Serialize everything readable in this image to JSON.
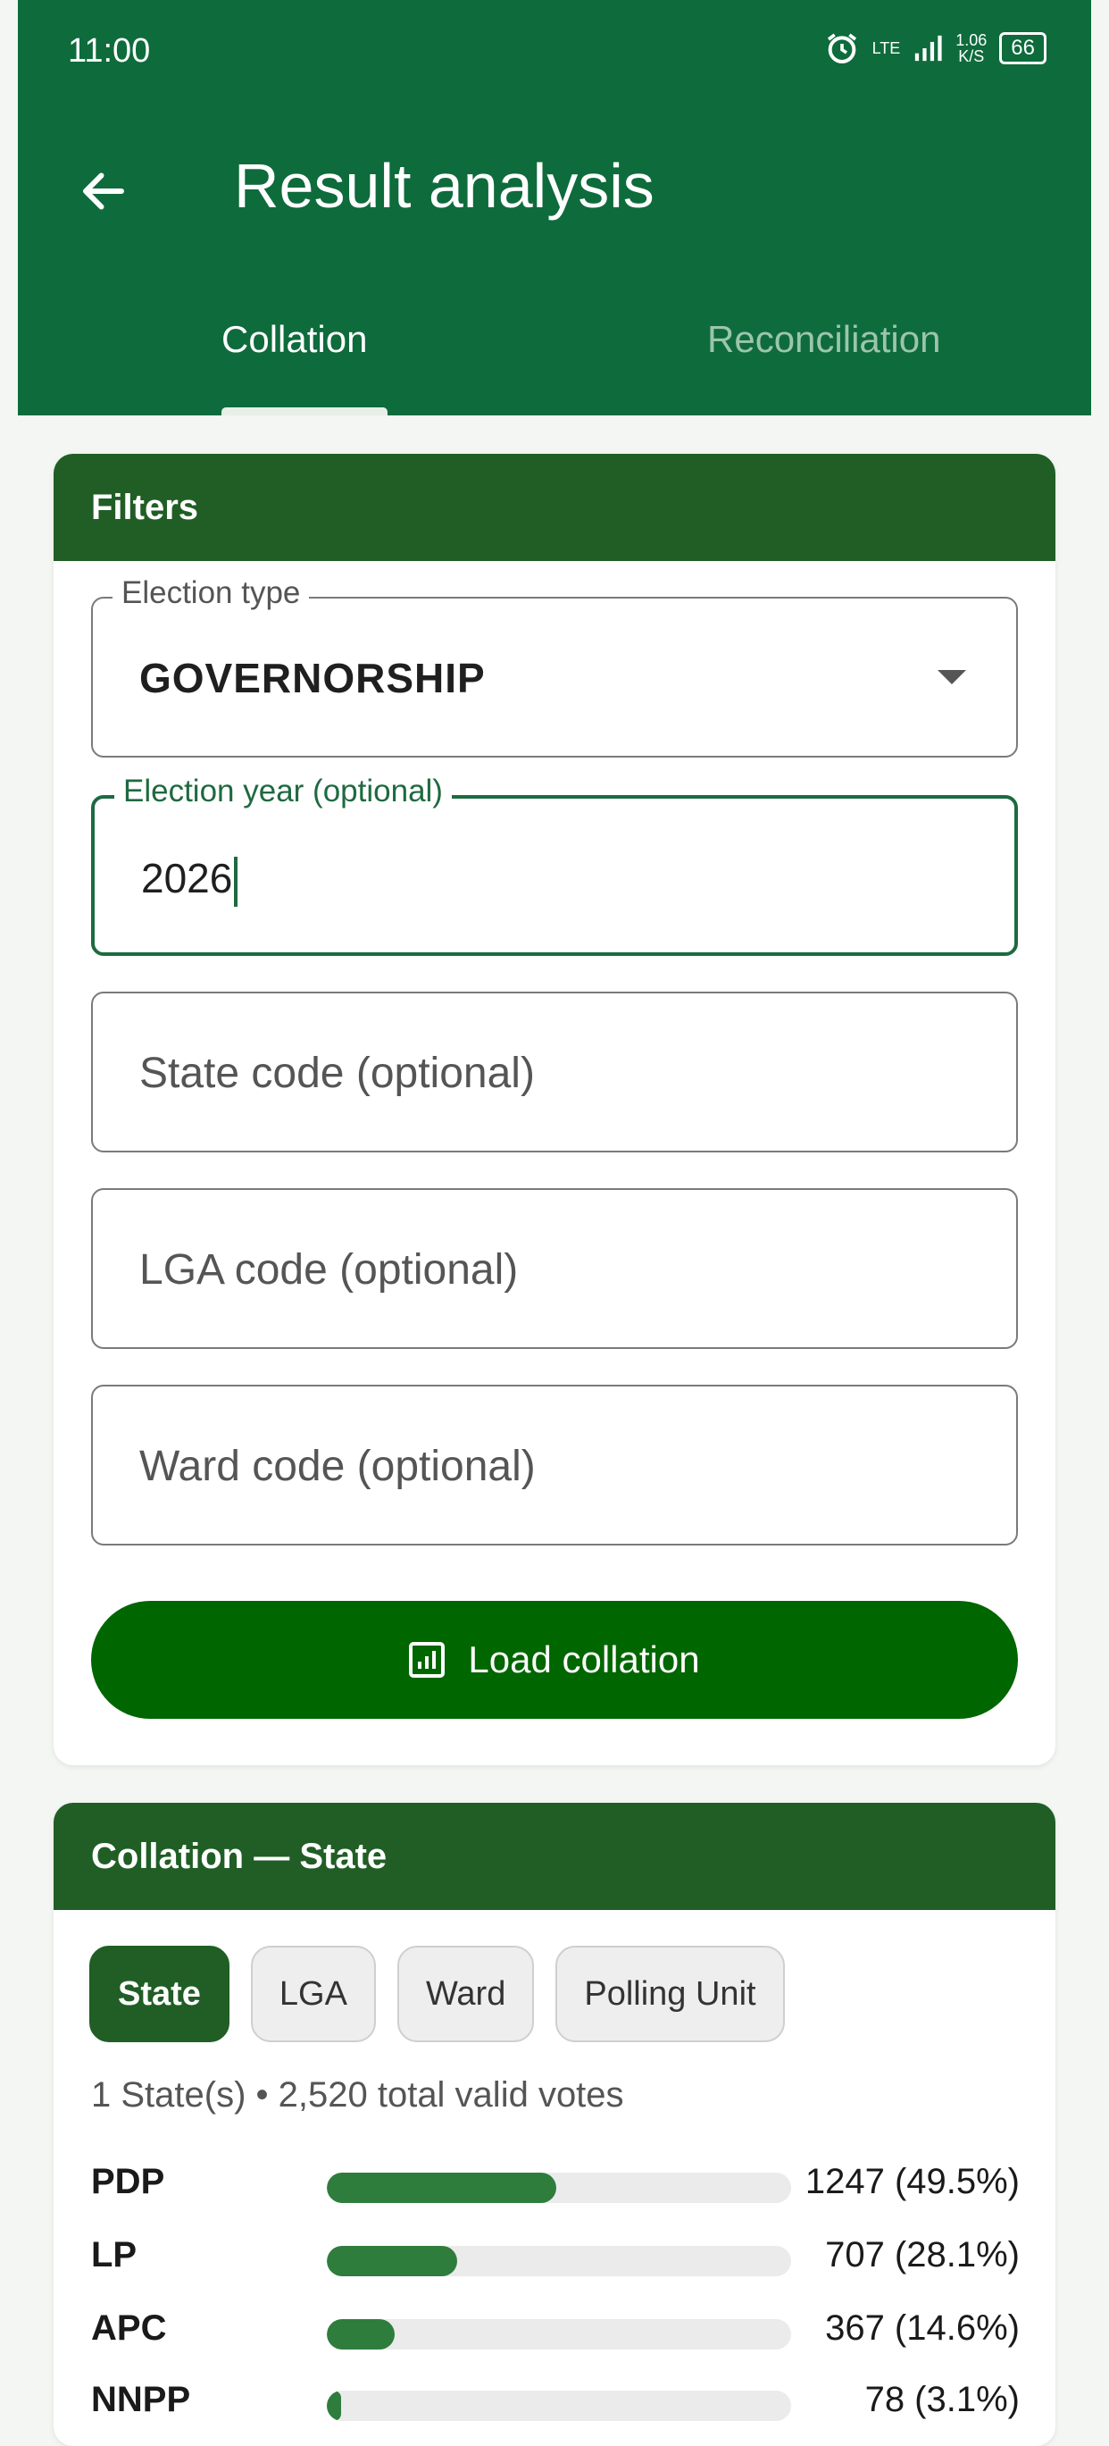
{
  "status_bar": {
    "time": "11:00",
    "network": "LTE",
    "speed_value": "1.06",
    "speed_unit": "K/S",
    "battery": "66"
  },
  "header": {
    "title": "Result analysis",
    "tabs": [
      {
        "label": "Collation",
        "active": true
      },
      {
        "label": "Reconciliation",
        "active": false
      }
    ]
  },
  "filters": {
    "header": "Filters",
    "election_type": {
      "label": "Election type",
      "value": "GOVERNORSHIP"
    },
    "election_year": {
      "label": "Election year (optional)",
      "value": "2026"
    },
    "state_code": {
      "placeholder": "State code (optional)"
    },
    "lga_code": {
      "placeholder": "LGA code (optional)"
    },
    "ward_code": {
      "placeholder": "Ward code (optional)"
    },
    "load_button": "Load collation"
  },
  "collation": {
    "header": "Collation — State",
    "chips": [
      {
        "label": "State",
        "selected": true
      },
      {
        "label": "LGA",
        "selected": false
      },
      {
        "label": "Ward",
        "selected": false
      },
      {
        "label": "Polling Unit",
        "selected": false
      }
    ],
    "summary": "1 State(s) • 2,520 total valid votes",
    "results": [
      {
        "party": "PDP",
        "votes": "1247 (49.5%)",
        "share": 0.495
      },
      {
        "party": "LP",
        "votes": "707 (28.1%)",
        "share": 0.281
      },
      {
        "party": "APC",
        "votes": "367 (14.6%)",
        "share": 0.146
      },
      {
        "party": "NNPP",
        "votes": "78 (3.1%)",
        "share": 0.031
      }
    ]
  },
  "colors": {
    "appbar": "#0e6b3c",
    "card_header": "#205e25",
    "button": "#006600",
    "bar_fill": "#2f7d3d"
  }
}
